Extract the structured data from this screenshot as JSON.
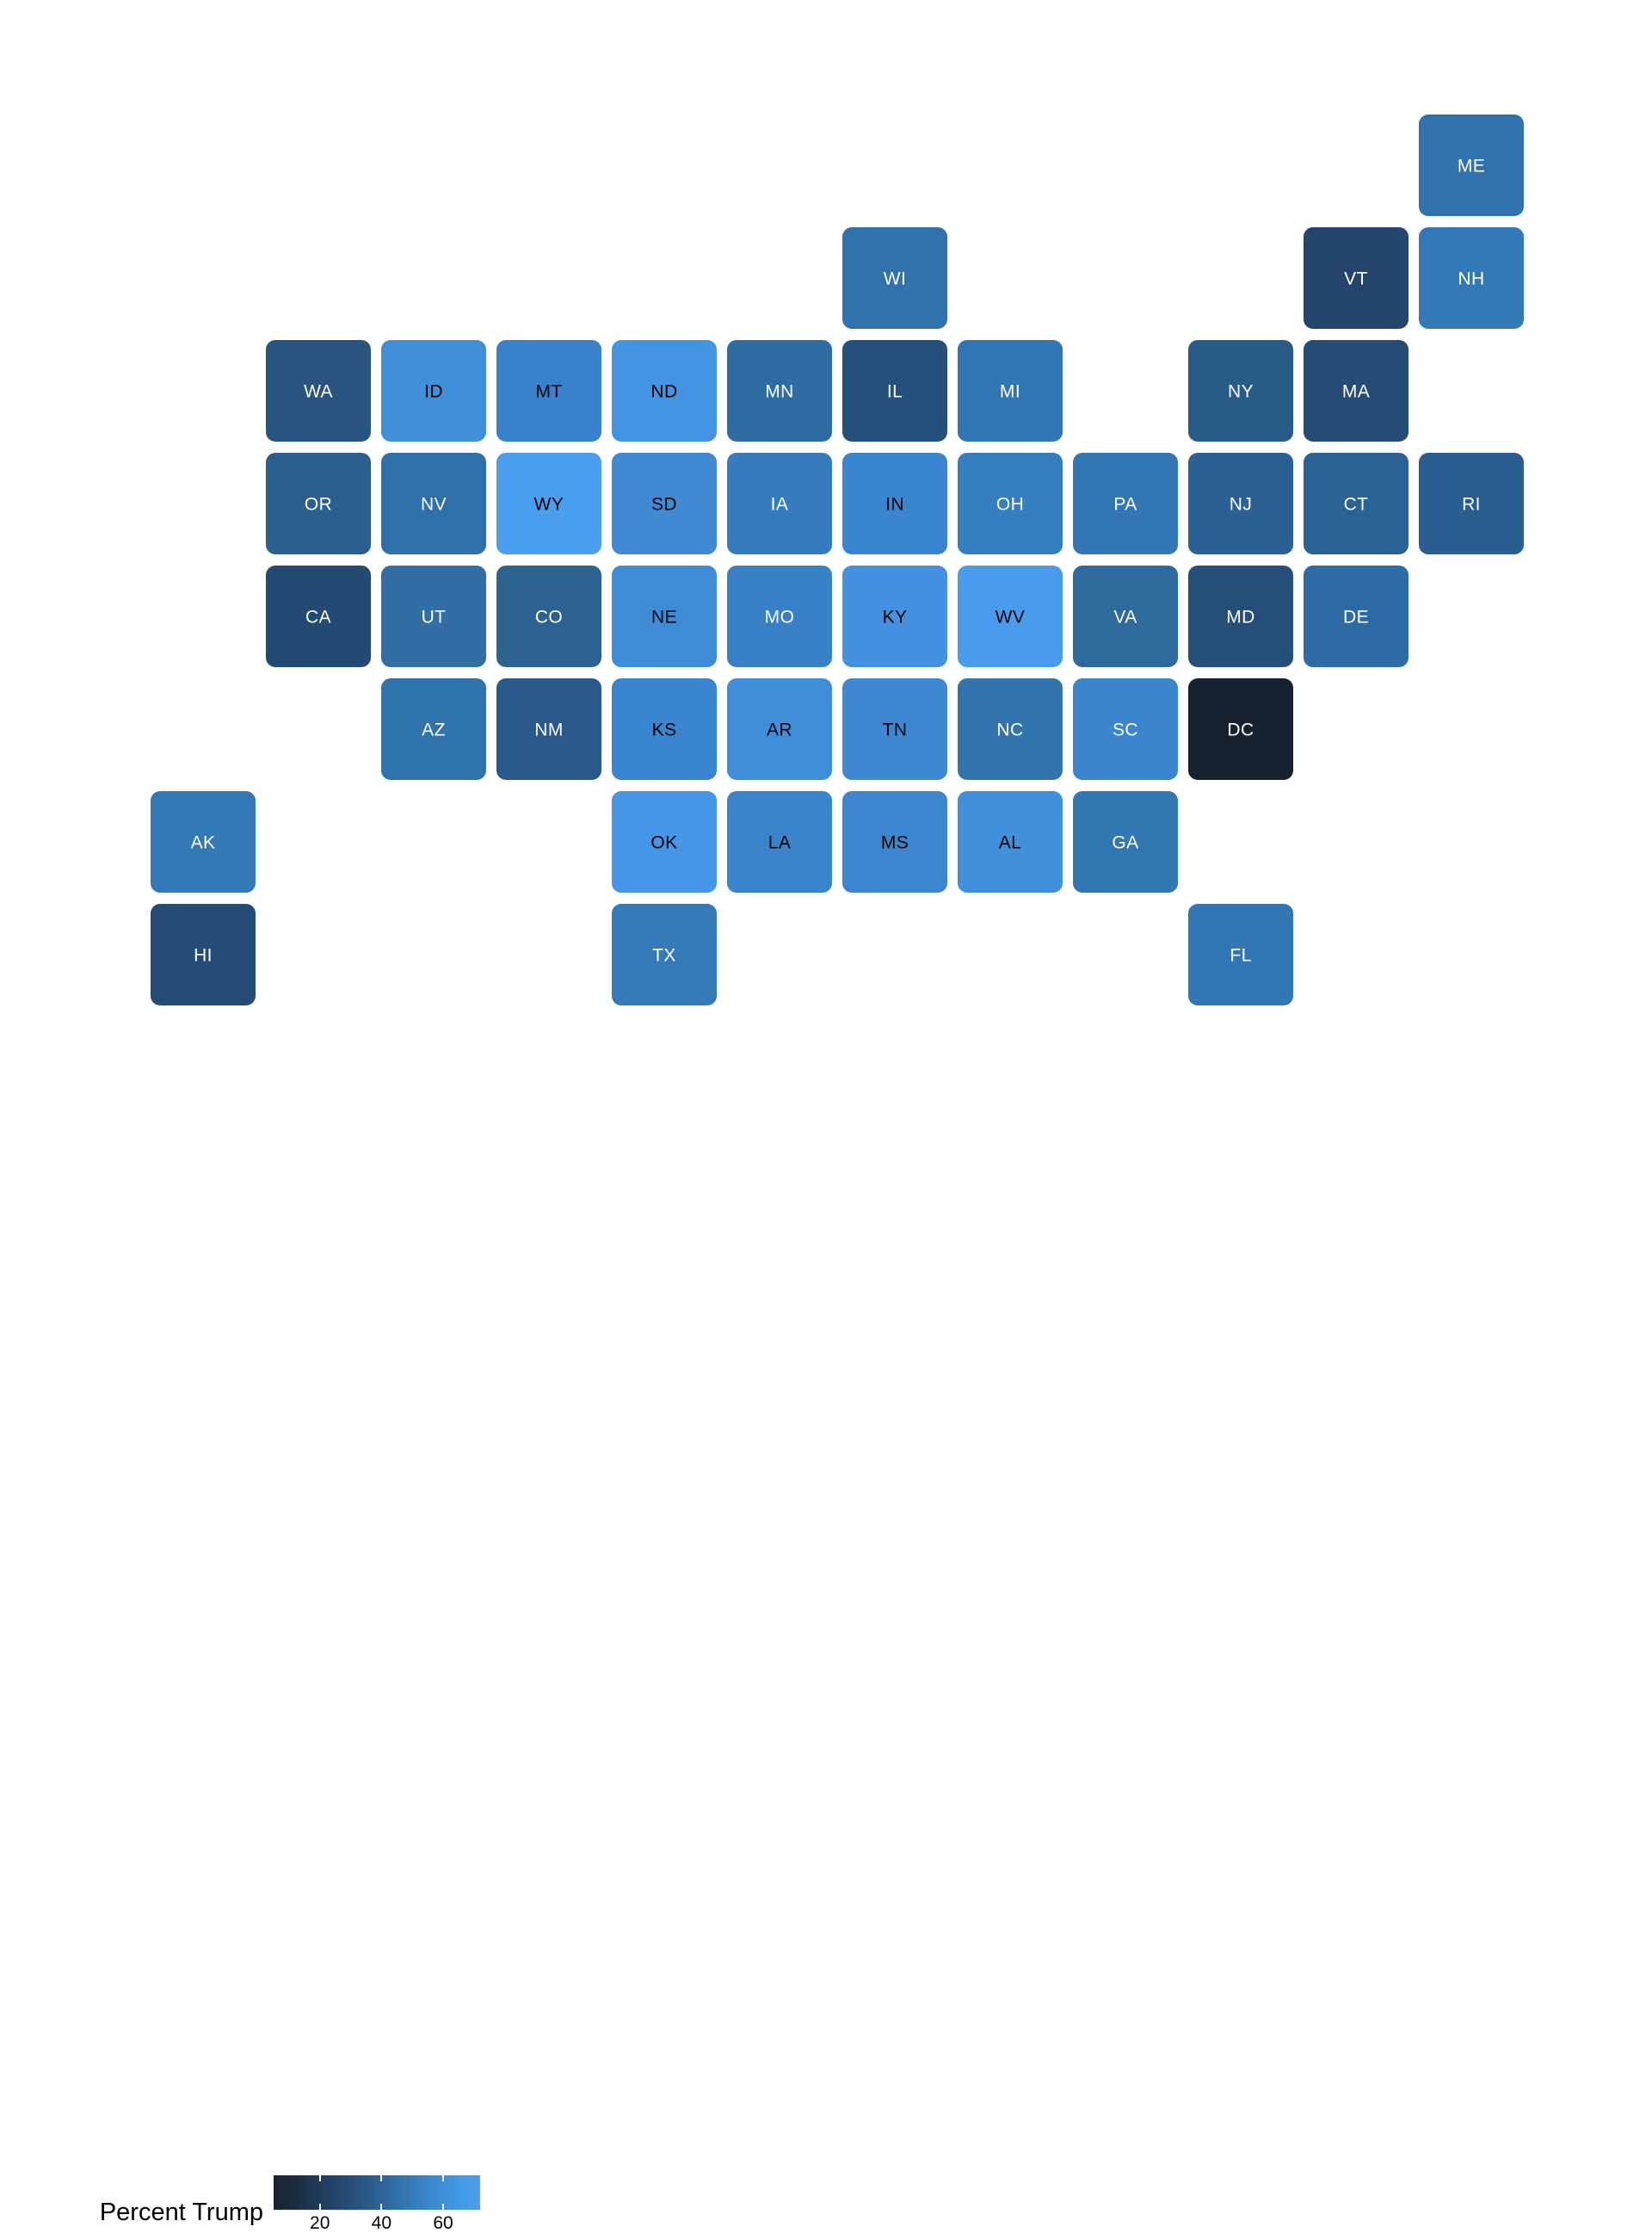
{
  "legend": {
    "title": "Percent Trump",
    "ticks": [
      {
        "label": "20",
        "value": 20
      },
      {
        "label": "40",
        "value": 40
      },
      {
        "label": "60",
        "value": 60
      }
    ],
    "vmin": 5,
    "vmax": 72,
    "gradient_low_color": "#16222f",
    "gradient_high_color": "#4a9eee",
    "orientation": "horizontal"
  },
  "chart_data": {
    "type": "heatmap",
    "subtype": "tile-grid-cartogram",
    "title": "",
    "subtitle": "",
    "xlabel": "",
    "ylabel": "",
    "colorbar_label": "Percent Trump",
    "value_unit": "percent",
    "grid_columns": 12,
    "grid_rows": 8,
    "colorscale": "blues-dark-to-light",
    "clim": [
      5,
      72
    ],
    "legend_position": "bottom-left",
    "grid_on": false,
    "categories": [
      "ME",
      "WI",
      "VT",
      "NH",
      "WA",
      "ID",
      "MT",
      "ND",
      "MN",
      "IL",
      "MI",
      "NY",
      "MA",
      "OR",
      "NV",
      "WY",
      "SD",
      "IA",
      "IN",
      "OH",
      "PA",
      "NJ",
      "CT",
      "RI",
      "CA",
      "UT",
      "CO",
      "NE",
      "MO",
      "KY",
      "WV",
      "VA",
      "MD",
      "DE",
      "AZ",
      "NM",
      "KS",
      "AR",
      "TN",
      "NC",
      "SC",
      "DC",
      "AK",
      "OK",
      "LA",
      "MS",
      "AL",
      "GA",
      "HI",
      "TX",
      "FL"
    ],
    "values": [
      49,
      47,
      31,
      52,
      39,
      60,
      57,
      64,
      45,
      40,
      48,
      38,
      33,
      41,
      46,
      70,
      62,
      53,
      57,
      53,
      49,
      41,
      41,
      39,
      32,
      58,
      42,
      59,
      57,
      62,
      69,
      44,
      32,
      44,
      49,
      40,
      57,
      61,
      61,
      50,
      55,
      5,
      53,
      65,
      58,
      58,
      62,
      51,
      30,
      52,
      51
    ],
    "tiles": [
      {
        "state": "ME",
        "label": "ME",
        "row": 0,
        "col": 10,
        "value": 49,
        "color": "#2f72ae",
        "label_color": "#ffffff"
      },
      {
        "state": "WI",
        "label": "WI",
        "row": 1,
        "col": 5,
        "value": 47,
        "color": "#2f72ae",
        "label_color": "#ffffff"
      },
      {
        "state": "VT",
        "label": "VT",
        "row": 1,
        "col": 9,
        "value": 31,
        "color": "#25446e",
        "label_color": "#ffffff"
      },
      {
        "state": "NH",
        "label": "NH",
        "row": 1,
        "col": 10,
        "value": 52,
        "color": "#3279b8",
        "label_color": "#ffffff"
      },
      {
        "state": "WA",
        "label": "WA",
        "row": 2,
        "col": 0,
        "value": 39,
        "color": "#28557f",
        "label_color": "#ffffff"
      },
      {
        "state": "ID",
        "label": "ID",
        "row": 2,
        "col": 1,
        "value": 60,
        "color": "#3f8fdb",
        "label_color": "#000000"
      },
      {
        "state": "MT",
        "label": "MT",
        "row": 2,
        "col": 2,
        "value": 57,
        "color": "#3982cb",
        "label_color": "#000000"
      },
      {
        "state": "ND",
        "label": "ND",
        "row": 2,
        "col": 3,
        "value": 64,
        "color": "#4494e4",
        "label_color": "#000000"
      },
      {
        "state": "MN",
        "label": "MN",
        "row": 2,
        "col": 4,
        "value": 45,
        "color": "#2e6ca4",
        "label_color": "#ffffff"
      },
      {
        "state": "IL",
        "label": "IL",
        "row": 2,
        "col": 5,
        "value": 40,
        "color": "#25507b",
        "label_color": "#ffffff"
      },
      {
        "state": "MI",
        "label": "MI",
        "row": 2,
        "col": 6,
        "value": 48,
        "color": "#3176b2",
        "label_color": "#ffffff"
      },
      {
        "state": "NY",
        "label": "NY",
        "row": 2,
        "col": 8,
        "value": 38,
        "color": "#295b89",
        "label_color": "#ffffff"
      },
      {
        "state": "MA",
        "label": "MA",
        "row": 2,
        "col": 9,
        "value": 33,
        "color": "#264c76",
        "label_color": "#ffffff"
      },
      {
        "state": "OR",
        "label": "OR",
        "row": 3,
        "col": 0,
        "value": 41,
        "color": "#2a5f8f",
        "label_color": "#ffffff"
      },
      {
        "state": "NV",
        "label": "NV",
        "row": 3,
        "col": 1,
        "value": 46,
        "color": "#2f70aa",
        "label_color": "#ffffff"
      },
      {
        "state": "WY",
        "label": "WY",
        "row": 3,
        "col": 2,
        "value": 70,
        "color": "#4a9eee",
        "label_color": "#000000"
      },
      {
        "state": "SD",
        "label": "SD",
        "row": 3,
        "col": 3,
        "value": 62,
        "color": "#4089d3",
        "label_color": "#000000"
      },
      {
        "state": "IA",
        "label": "IA",
        "row": 3,
        "col": 4,
        "value": 53,
        "color": "#347cbd",
        "label_color": "#ffffff"
      },
      {
        "state": "IN",
        "label": "IN",
        "row": 3,
        "col": 5,
        "value": 57,
        "color": "#3a85cf",
        "label_color": "#000000"
      },
      {
        "state": "OH",
        "label": "OH",
        "row": 3,
        "col": 6,
        "value": 53,
        "color": "#357ec0",
        "label_color": "#ffffff"
      },
      {
        "state": "PA",
        "label": "PA",
        "row": 3,
        "col": 7,
        "value": 49,
        "color": "#3276b4",
        "label_color": "#ffffff"
      },
      {
        "state": "NJ",
        "label": "NJ",
        "row": 3,
        "col": 8,
        "value": 41,
        "color": "#2a6094",
        "label_color": "#ffffff"
      },
      {
        "state": "CT",
        "label": "CT",
        "row": 3,
        "col": 9,
        "value": 41,
        "color": "#2b6296",
        "label_color": "#ffffff"
      },
      {
        "state": "RI",
        "label": "RI",
        "row": 3,
        "col": 10,
        "value": 39,
        "color": "#2a5e90",
        "label_color": "#ffffff"
      },
      {
        "state": "CA",
        "label": "CA",
        "row": 4,
        "col": 0,
        "value": 32,
        "color": "#234a72",
        "label_color": "#ffffff"
      },
      {
        "state": "UT",
        "label": "UT",
        "row": 4,
        "col": 1,
        "value": 58,
        "color": "#326ea4",
        "label_color": "#ffffff"
      },
      {
        "state": "CO",
        "label": "CO",
        "row": 4,
        "col": 2,
        "value": 42,
        "color": "#2c628f",
        "label_color": "#ffffff"
      },
      {
        "state": "NE",
        "label": "NE",
        "row": 4,
        "col": 3,
        "value": 59,
        "color": "#3e8bd6",
        "label_color": "#000000"
      },
      {
        "state": "MO",
        "label": "MO",
        "row": 4,
        "col": 4,
        "value": 57,
        "color": "#3780c6",
        "label_color": "#ffffff"
      },
      {
        "state": "KY",
        "label": "KY",
        "row": 4,
        "col": 5,
        "value": 62,
        "color": "#4391e0",
        "label_color": "#000000"
      },
      {
        "state": "WV",
        "label": "WV",
        "row": 4,
        "col": 6,
        "value": 69,
        "color": "#499cec",
        "label_color": "#000000"
      },
      {
        "state": "VA",
        "label": "VA",
        "row": 4,
        "col": 7,
        "value": 44,
        "color": "#2e6a9e",
        "label_color": "#ffffff"
      },
      {
        "state": "MD",
        "label": "MD",
        "row": 4,
        "col": 8,
        "value": 32,
        "color": "#254e79",
        "label_color": "#ffffff"
      },
      {
        "state": "DE",
        "label": "DE",
        "row": 4,
        "col": 9,
        "value": 44,
        "color": "#2d6ba5",
        "label_color": "#ffffff"
      },
      {
        "state": "AZ",
        "label": "AZ",
        "row": 5,
        "col": 1,
        "value": 49,
        "color": "#2f73ad",
        "label_color": "#ffffff"
      },
      {
        "state": "NM",
        "label": "NM",
        "row": 5,
        "col": 2,
        "value": 40,
        "color": "#29588a",
        "label_color": "#ffffff"
      },
      {
        "state": "KS",
        "label": "KS",
        "row": 5,
        "col": 3,
        "value": 57,
        "color": "#3a85cf",
        "label_color": "#000000"
      },
      {
        "state": "AR",
        "label": "AR",
        "row": 5,
        "col": 4,
        "value": 61,
        "color": "#3f8ed9",
        "label_color": "#000000"
      },
      {
        "state": "TN",
        "label": "TN",
        "row": 5,
        "col": 5,
        "value": 61,
        "color": "#3d88d0",
        "label_color": "#000000"
      },
      {
        "state": "NC",
        "label": "NC",
        "row": 5,
        "col": 6,
        "value": 50,
        "color": "#3174ae",
        "label_color": "#ffffff"
      },
      {
        "state": "SC",
        "label": "SC",
        "row": 5,
        "col": 7,
        "value": 55,
        "color": "#3a85cc",
        "label_color": "#ffffff"
      },
      {
        "state": "DC",
        "label": "DC",
        "row": 5,
        "col": 8,
        "value": 5,
        "color": "#16222f",
        "label_color": "#ffffff"
      },
      {
        "state": "AK",
        "label": "AK",
        "row": 6,
        "col": -1,
        "value": 53,
        "color": "#3279b6",
        "label_color": "#ffffff"
      },
      {
        "state": "OK",
        "label": "OK",
        "row": 6,
        "col": 3,
        "value": 65,
        "color": "#4596e6",
        "label_color": "#000000"
      },
      {
        "state": "LA",
        "label": "LA",
        "row": 6,
        "col": 4,
        "value": 58,
        "color": "#3a84cc",
        "label_color": "#000000"
      },
      {
        "state": "MS",
        "label": "MS",
        "row": 6,
        "col": 5,
        "value": 58,
        "color": "#3b86ce",
        "label_color": "#000000"
      },
      {
        "state": "AL",
        "label": "AL",
        "row": 6,
        "col": 6,
        "value": 62,
        "color": "#4090dc",
        "label_color": "#000000"
      },
      {
        "state": "GA",
        "label": "GA",
        "row": 6,
        "col": 7,
        "value": 51,
        "color": "#3178b2",
        "label_color": "#ffffff"
      },
      {
        "state": "HI",
        "label": "HI",
        "row": 7,
        "col": -1,
        "value": 30,
        "color": "#254c76",
        "label_color": "#ffffff"
      },
      {
        "state": "TX",
        "label": "TX",
        "row": 7,
        "col": 3,
        "value": 52,
        "color": "#3479b8",
        "label_color": "#ffffff"
      },
      {
        "state": "FL",
        "label": "FL",
        "row": 7,
        "col": 8,
        "value": 51,
        "color": "#3277b4",
        "label_color": "#ffffff"
      }
    ]
  }
}
